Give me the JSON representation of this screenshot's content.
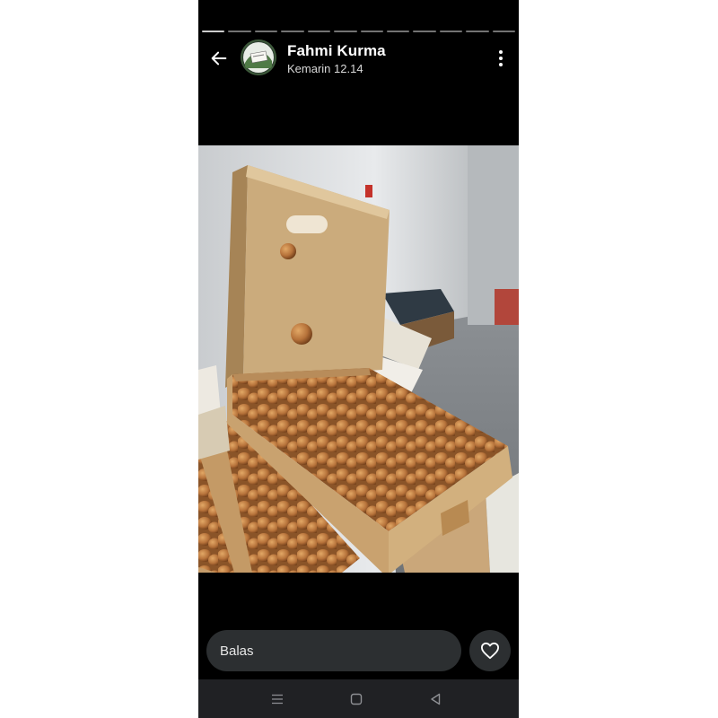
{
  "status": {
    "segments": 12,
    "author_name": "Fahmi Kurma",
    "timestamp": "Kemarin 12.14"
  },
  "header": {
    "back_icon": "arrow-left-icon",
    "menu_icon": "more-vertical-icon"
  },
  "media": {
    "description_icon": "photo"
  },
  "reply": {
    "placeholder": "Balas",
    "like_icon": "heart-icon"
  },
  "system_nav": {
    "recent_icon": "recent-apps-icon",
    "home_icon": "home-icon",
    "back_icon": "nav-back-icon"
  },
  "colors": {
    "background": "#000000",
    "reply_bar": "#2c2f31",
    "nav_bar": "#202124"
  }
}
